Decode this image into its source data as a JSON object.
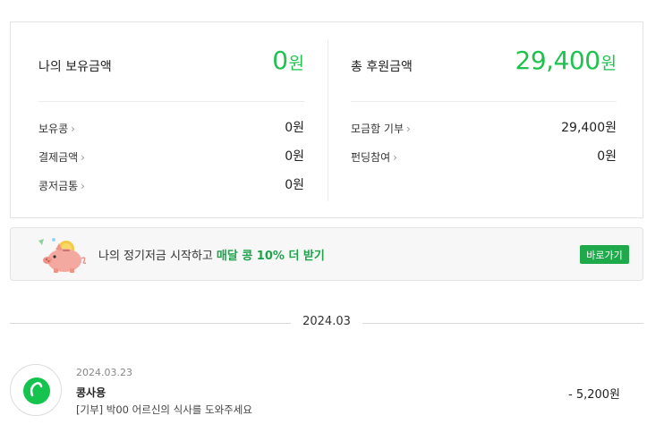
{
  "summary": {
    "left": {
      "title": "나의 보유금액",
      "amount": "0",
      "unit": "원",
      "rows": [
        {
          "label": "보유콩",
          "value": "0원"
        },
        {
          "label": "결제금액",
          "value": "0원"
        },
        {
          "label": "콩저금통",
          "value": "0원"
        }
      ]
    },
    "right": {
      "title": "총 후원금액",
      "amount": "29,400",
      "unit": "원",
      "rows": [
        {
          "label": "모금함 기부",
          "value": "29,400원"
        },
        {
          "label": "펀딩참여",
          "value": "0원"
        }
      ]
    },
    "chevron": "›",
    "accent_color": "#1ec34f"
  },
  "banner": {
    "icon": "piggy-bank-icon",
    "text": "나의 정기저금 시작하고",
    "highlight": "매달 콩 10% 더 받기",
    "button_label": "바로가기"
  },
  "history": {
    "month": "2024.03",
    "items": [
      {
        "icon": "bean-logo-icon",
        "date": "2024.03.23",
        "title": "콩사용",
        "description": "[기부] 박00 어르신의 식사를 도와주세요",
        "amount": "- 5,200원"
      }
    ]
  }
}
